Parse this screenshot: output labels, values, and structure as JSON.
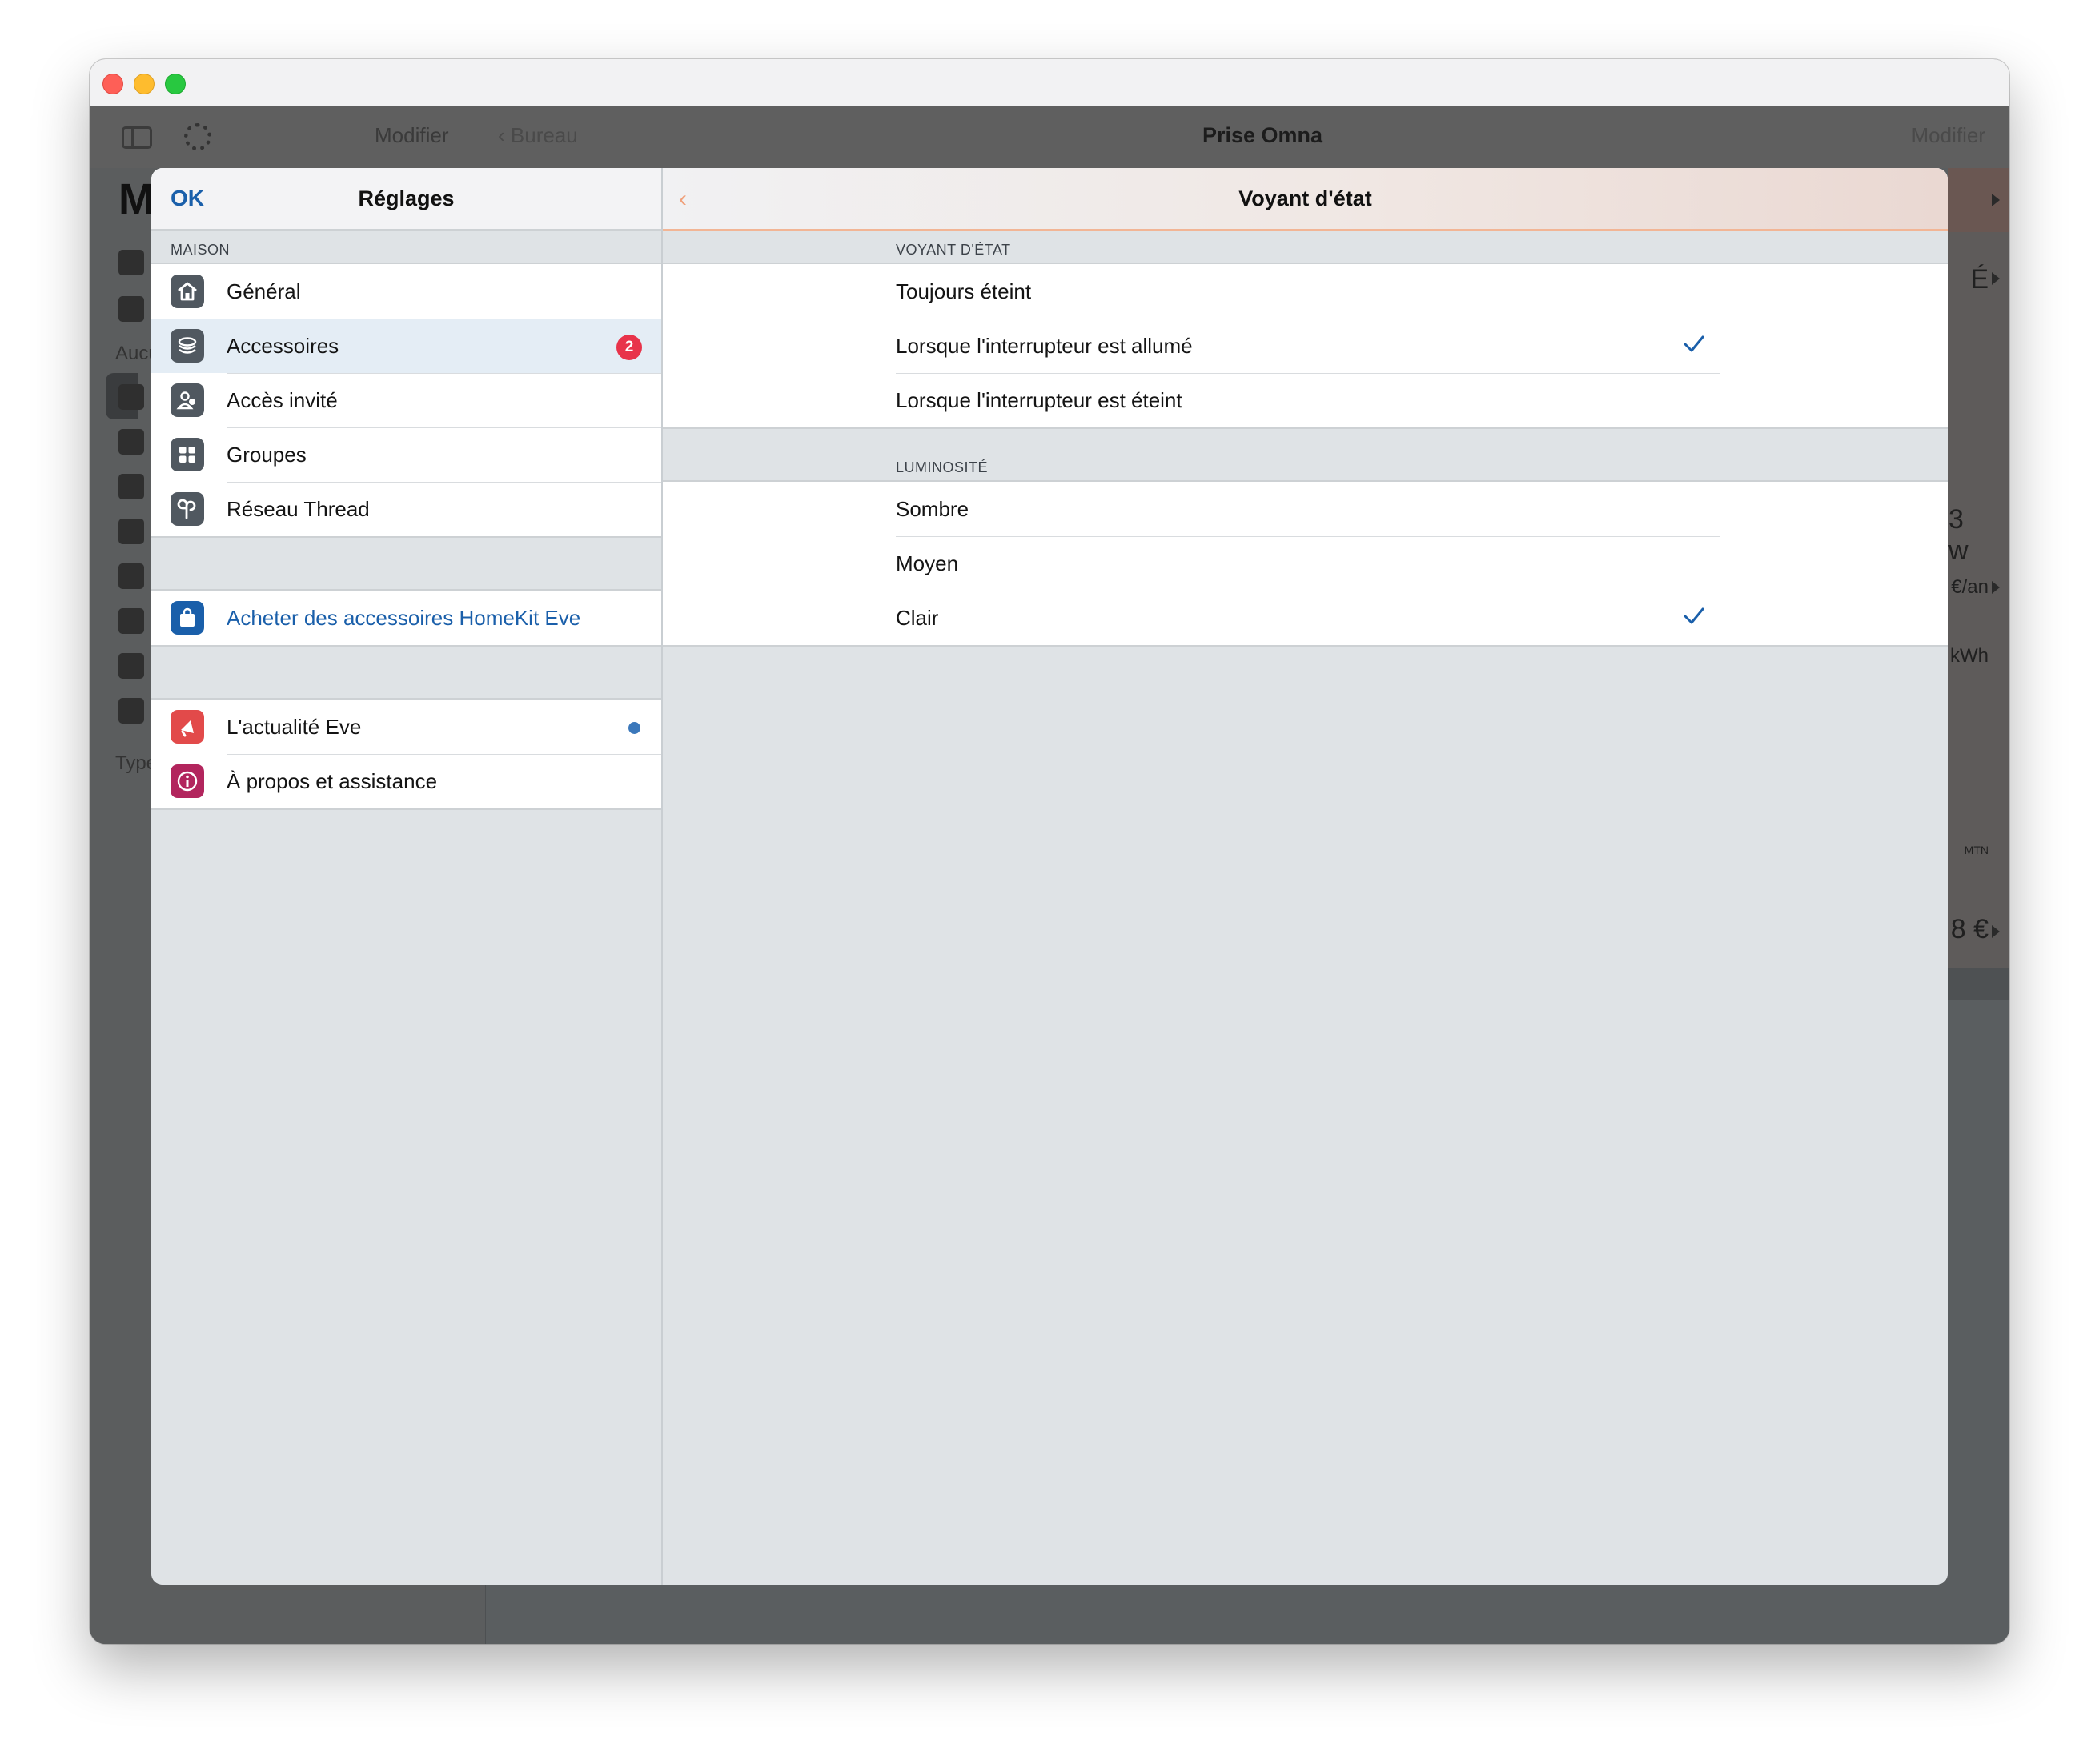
{
  "background_app": {
    "edit_left": "Modifier",
    "back_label": "Bureau",
    "title": "Prise Omna",
    "edit_right": "Modifier",
    "sidebar_heading": "M",
    "sidebar_label_1": "Aucu",
    "sidebar_label_2": "Type",
    "right_fragments": [
      "É",
      "3 w",
      "€/an",
      "kWh",
      "MTN",
      "8 €"
    ]
  },
  "settings_nav": {
    "done_label": "OK",
    "title": "Réglages"
  },
  "settings_sidebar": {
    "section_home": "MAISON",
    "items": [
      {
        "label": "Général",
        "icon": "house-icon",
        "color": "#505860"
      },
      {
        "label": "Accessoires",
        "icon": "layers-icon",
        "color": "#505860",
        "badge": "2",
        "selected": true
      },
      {
        "label": "Accès invité",
        "icon": "guest-users-icon",
        "color": "#505860"
      },
      {
        "label": "Groupes",
        "icon": "grid-icon",
        "color": "#505860"
      },
      {
        "label": "Réseau Thread",
        "icon": "thread-icon",
        "color": "#505860"
      }
    ],
    "shop_item": {
      "label": "Acheter des accessoires HomeKit Eve",
      "icon": "shopping-bag-icon",
      "color": "#1a5faa"
    },
    "info_items": [
      {
        "label": "L'actualité Eve",
        "icon": "megaphone-icon",
        "color": "#e24a4a",
        "unread": true
      },
      {
        "label": "À propos et assistance",
        "icon": "info-icon",
        "color": "#b2255d"
      }
    ]
  },
  "detail_nav": {
    "title": "Voyant d'état"
  },
  "detail": {
    "status_light": {
      "header": "VOYANT D'ÉTAT",
      "options": [
        {
          "label": "Toujours éteint",
          "checked": false
        },
        {
          "label": "Lorsque l'interrupteur est allumé",
          "checked": true
        },
        {
          "label": "Lorsque l'interrupteur est éteint",
          "checked": false
        }
      ]
    },
    "brightness": {
      "header": "LUMINOSITÉ",
      "options": [
        {
          "label": "Sombre",
          "checked": false
        },
        {
          "label": "Moyen",
          "checked": false
        },
        {
          "label": "Clair",
          "checked": true
        }
      ]
    }
  },
  "colors": {
    "accent_blue": "#1a5faa",
    "badge_red": "#e8334a",
    "nav_accent_orange": "#f2b595"
  }
}
